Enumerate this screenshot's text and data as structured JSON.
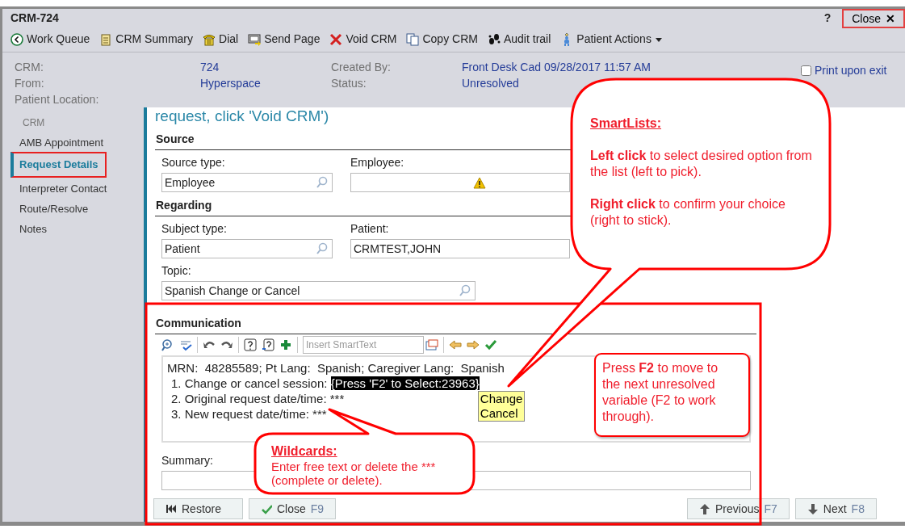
{
  "window": {
    "title": "CRM-724",
    "help": "?",
    "close": {
      "label": "Close",
      "glyph": "✕",
      "highlighted": true
    }
  },
  "toolbar": [
    {
      "label": "Work Queue",
      "kind": "back"
    },
    {
      "label": "CRM Summary",
      "kind": "notepad"
    },
    {
      "label": "Dial",
      "kind": "phone"
    },
    {
      "label": "Send Page",
      "kind": "pager"
    },
    {
      "label": "Void CRM",
      "kind": "void"
    },
    {
      "label": "Copy CRM",
      "kind": "copy"
    },
    {
      "label": "Audit trail",
      "kind": "footprints"
    },
    {
      "label": "Patient Actions",
      "kind": "person",
      "dropdown": true
    }
  ],
  "header": {
    "left": [
      {
        "label": "CRM:",
        "value": "724"
      },
      {
        "label": "From:",
        "value": "Hyperspace"
      },
      {
        "label": "Patient Location:"
      }
    ],
    "right": [
      {
        "label": "Created By:",
        "value": "Front Desk Cad 09/28/2017 11:57 AM"
      },
      {
        "label": "Status:",
        "value": "Unresolved"
      }
    ],
    "print_upon_exit": {
      "label": "Print upon exit",
      "checked": false
    }
  },
  "sidebar": {
    "heading": "CRM",
    "items": [
      {
        "label": "AMB Appointment",
        "selected": false,
        "highlighted": false
      },
      {
        "label": "Request Details",
        "selected": true,
        "highlighted": true
      },
      {
        "label": "Interpreter Contact",
        "selected": false,
        "highlighted": false
      },
      {
        "label": "Route/Resolve",
        "selected": false,
        "highlighted": false
      },
      {
        "label": "Notes",
        "selected": false,
        "highlighted": false
      }
    ]
  },
  "form": {
    "banner": "request, click 'Void CRM')",
    "source": {
      "title": "Source",
      "fields": [
        {
          "label": "Source type:",
          "value": "Employee",
          "kind": "lookup"
        },
        {
          "label": "Employee:",
          "kind": "warning"
        }
      ]
    },
    "regarding": {
      "title": "Regarding",
      "fields": [
        {
          "label": "Subject type:",
          "value": "Patient",
          "kind": "lookup"
        },
        {
          "label": "Patient:",
          "value": "CRMTEST,JOHN",
          "kind": "text"
        }
      ],
      "topic": {
        "label": "Topic:",
        "value": "Spanish Change or Cancel"
      }
    },
    "communication": {
      "title": "Communication",
      "highlighted": true,
      "smarttext_placeholder": "Insert SmartText",
      "lines": [
        "MRN:  48285589; Pt Lang:  Spanish; Caregiver Lang:  Spanish",
        "1. Change or cancel session: ",
        "2. Original request date/time: ***",
        "3. New request date/time: ***"
      ],
      "smartlist": {
        "text": "{Press 'F2' to Select:23963}",
        "options": [
          "Change",
          "Cancel"
        ]
      }
    },
    "summary": {
      "label": "Summary:"
    }
  },
  "buttons": [
    {
      "label": "Restore",
      "kind": "restore"
    },
    {
      "label": "Close",
      "shortcut": "F9",
      "kind": "close"
    },
    {
      "label": "Previous",
      "shortcut": "F7",
      "kind": "previous"
    },
    {
      "label": "Next",
      "shortcut": "F8",
      "kind": "next"
    }
  ],
  "callouts": [
    {
      "kind": "smartlists",
      "title": "SmartLists:",
      "paragraphs": [
        "**Left click** to select desired option from the list (left to pick).",
        "**Right click** to confirm your choice (right to stick)."
      ]
    },
    {
      "kind": "f2",
      "paragraphs": [
        "Press **F2** to move to the next unresolved variable (F2 to work through)."
      ]
    },
    {
      "kind": "wildcards",
      "title": "Wildcards:",
      "paragraphs": [
        "Enter free text or delete the *** (complete or delete)."
      ]
    }
  ]
}
